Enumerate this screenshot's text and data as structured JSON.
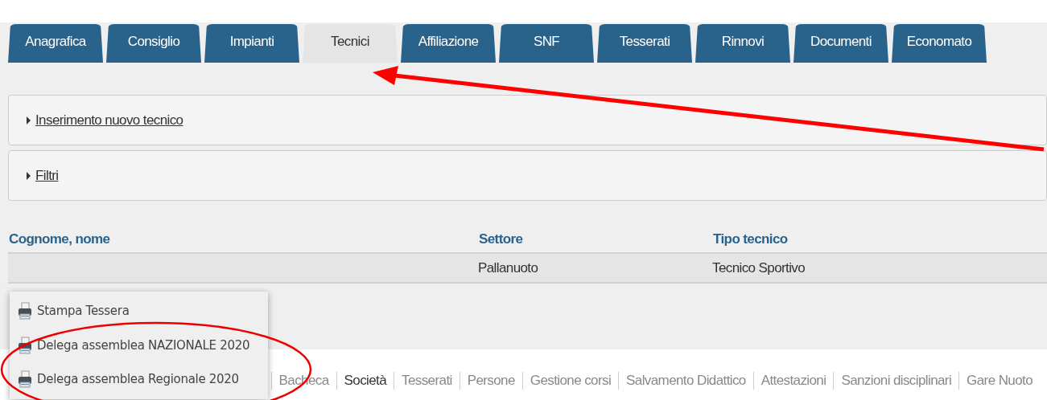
{
  "tabs": [
    {
      "label": "Anagrafica",
      "selected": false
    },
    {
      "label": "Consiglio",
      "selected": false
    },
    {
      "label": "Impianti",
      "selected": false
    },
    {
      "label": "Tecnici",
      "selected": true
    },
    {
      "label": "Affiliazione",
      "selected": false
    },
    {
      "label": "SNF",
      "selected": false
    },
    {
      "label": "Tesserati",
      "selected": false
    },
    {
      "label": "Rinnovi",
      "selected": false
    },
    {
      "label": "Documenti",
      "selected": false
    },
    {
      "label": "Economato",
      "selected": false
    }
  ],
  "sections": [
    {
      "label": "Inserimento nuovo tecnico",
      "expanded": false
    },
    {
      "label": "Filtri",
      "expanded": false
    }
  ],
  "table": {
    "columns": [
      "Cognome, nome",
      "Settore",
      "Tipo tecnico"
    ],
    "rows": [
      {
        "settore": "Pallanuoto",
        "tipo_tecnico": "Tecnico Sportivo"
      }
    ]
  },
  "context_menu": {
    "items": [
      {
        "label": "Stampa Tessera"
      },
      {
        "label": "Delega assemblea NAZIONALE 2020"
      },
      {
        "label": "Delega assemblea Regionale 2020"
      }
    ]
  },
  "footer_nav": [
    {
      "label": "Bacheca",
      "selected": false
    },
    {
      "label": "Società",
      "selected": true
    },
    {
      "label": "Tesserati",
      "selected": false
    },
    {
      "label": "Persone",
      "selected": false
    },
    {
      "label": "Gestione corsi",
      "selected": false
    },
    {
      "label": "Salvamento Didattico",
      "selected": false
    },
    {
      "label": "Attestazioni",
      "selected": false
    },
    {
      "label": "Sanzioni disciplinari",
      "selected": false
    },
    {
      "label": "Gare Nuoto",
      "selected": false
    }
  ],
  "annotations": {
    "arrow_to_selected_tab": true,
    "ellipse_around_menu_items": true
  }
}
